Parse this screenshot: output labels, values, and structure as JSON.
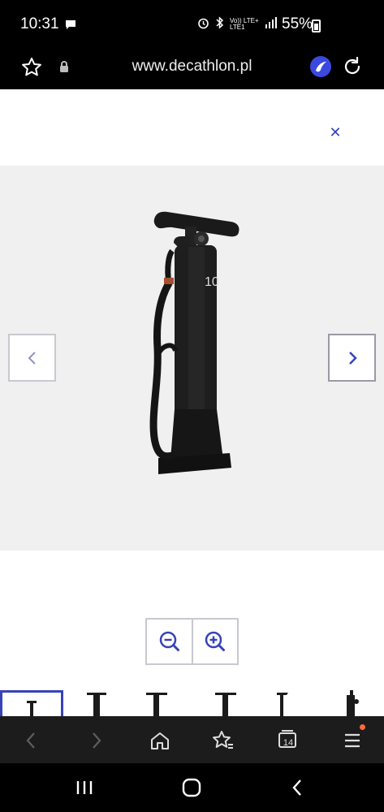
{
  "status_bar": {
    "time": "10:31",
    "network_label": "Vo)) LTE+\nLTE1",
    "battery": "55%"
  },
  "browser": {
    "url": "www.decathlon.pl",
    "tab_count": "14"
  },
  "page": {
    "close_symbol": "✕",
    "product_image_label": "10"
  },
  "gallery": {
    "thumbnail_count": 6,
    "active_thumbnail": 1
  },
  "colors": {
    "accent": "#3643ba",
    "gallery_bg": "#f0f0f0",
    "notification_dot": "#ff6a3d"
  },
  "icons": {
    "browser_left": [
      "star-outline-icon",
      "lock-icon"
    ],
    "browser_right": [
      "decathlon-app-icon",
      "refresh-icon"
    ],
    "toolbar": [
      "back-icon",
      "forward-icon",
      "home-icon",
      "bookmarks-icon",
      "tabs-icon",
      "menu-icon"
    ],
    "system_nav": [
      "recent-apps-icon",
      "home-circle-icon",
      "system-back-icon"
    ]
  }
}
